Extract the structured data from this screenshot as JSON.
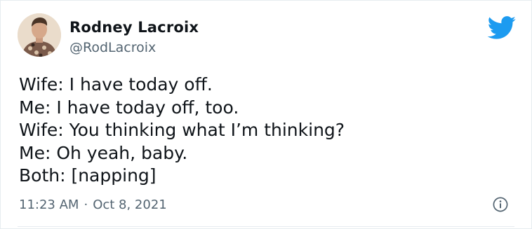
{
  "author": {
    "name": "Rodney Lacroix",
    "handle": "@RodLacroix",
    "avatar_icon": "user-avatar"
  },
  "tweet": {
    "lines": [
      "Wife: I have today off.",
      "Me: I have today off, too.",
      "Wife: You thinking what I’m thinking?",
      "Me: Oh yeah, baby.",
      "Both: [napping]"
    ],
    "time": "11:23 AM",
    "separator": "·",
    "date": "Oct 8, 2021"
  },
  "icons": {
    "brand": "twitter-bird-icon",
    "info": "info-icon"
  },
  "colors": {
    "brand": "#1d9bf0",
    "text": "#0f1419",
    "secondary": "#536471",
    "border": "#e6ecf0"
  }
}
